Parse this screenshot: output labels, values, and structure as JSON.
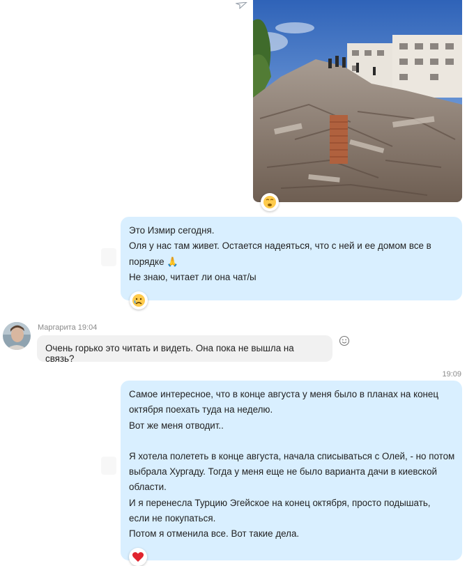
{
  "top_message": {
    "send_icon": "paper-plane-icon",
    "image_alt": "collapsed building rubble",
    "reaction": "worried-face-emoji"
  },
  "message_izmir": {
    "lines": [
      "Это Измир сегодня.",
      "Оля у нас там живет. Остается надеяться, что с ней и ее домом все в",
      "порядке 🙏",
      "Не знаю, читает ли она чат/ы"
    ],
    "reaction": "crying-face-emoji"
  },
  "incoming": {
    "sender": "Маргарита",
    "time": "19:04",
    "text": "Очень горько это читать и видеть. Она пока не вышла на связь?",
    "react_icon": "smiley-add-reaction-icon"
  },
  "message_plans": {
    "time": "19:09",
    "lines": [
      "Самое интересное, что в конце августа у меня было в планах на конец",
      "октября поехать туда на неделю.",
      "Вот же меня отводит..",
      "",
      "Я хотела полететь в конце августа, начала списываться с Олей, - но потом",
      "выбрала Хургаду. Тогда у меня еще не было варианта дачи в киевской",
      "области.",
      "И я перенесла Турцию Эгейское на конец октября, просто подышать,",
      "если не покупаться.",
      "Потом я отменила все. Вот такие дела."
    ],
    "reaction": "red-heart-emoji"
  }
}
